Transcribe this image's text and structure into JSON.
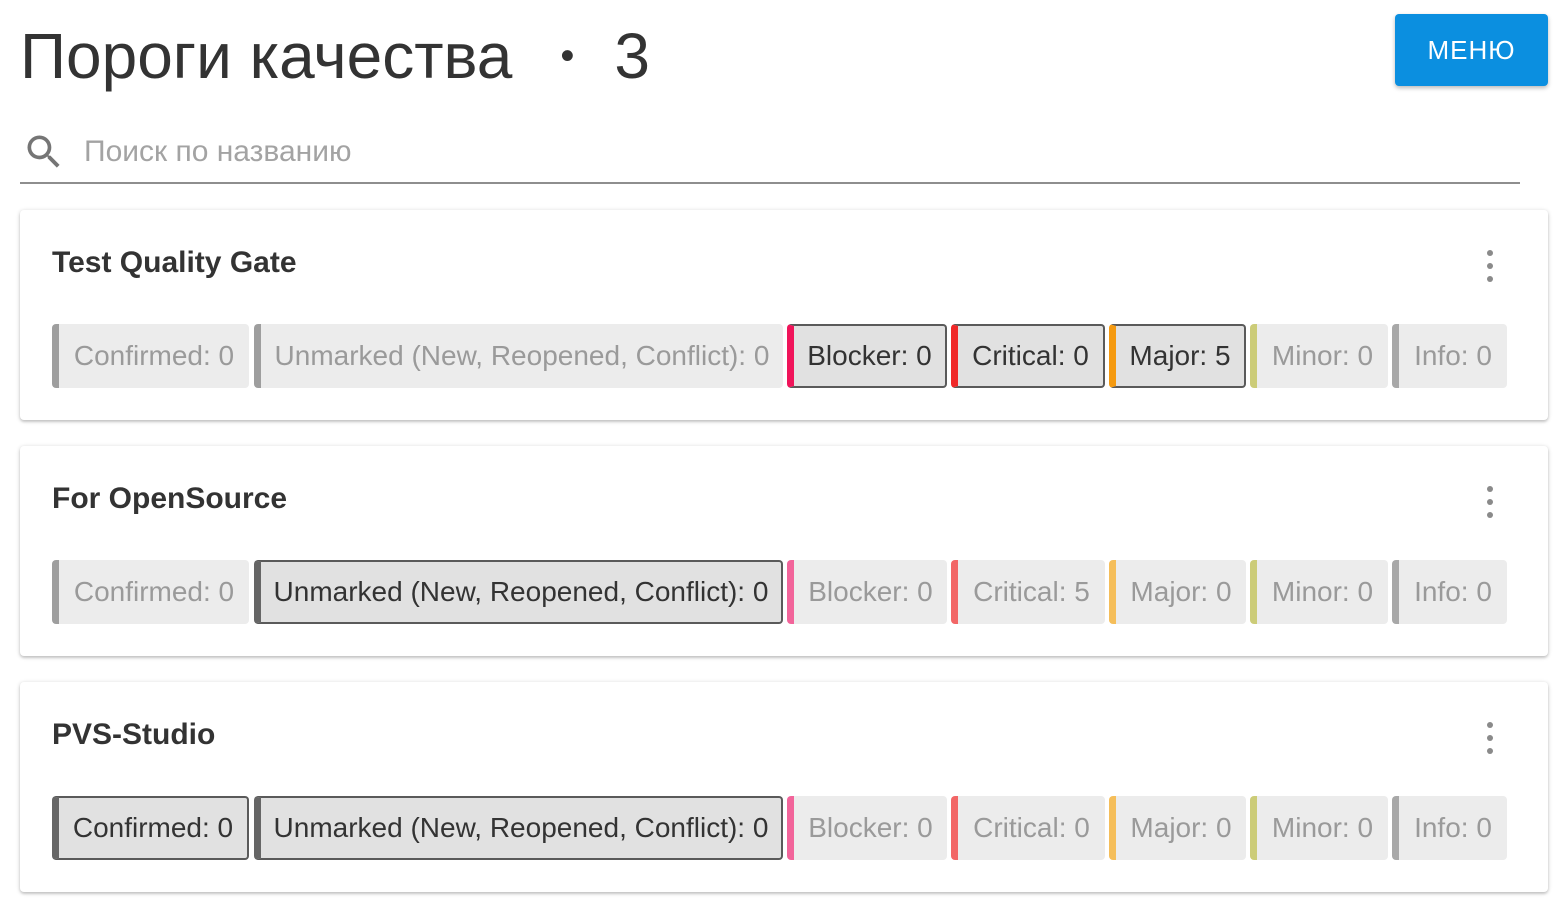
{
  "header": {
    "title": "Пороги качества",
    "separator": "•",
    "count": "3",
    "menu_label": "МЕНЮ"
  },
  "search": {
    "placeholder": "Поиск по названию",
    "value": "",
    "icon": "search-icon"
  },
  "colors": {
    "menu_button": "#0b8fe0",
    "confirmed": "#9e9e9e",
    "unmarked": "#9e9e9e",
    "blocker": "#f0145a",
    "critical": "#f02828",
    "major": "#f59a10",
    "minor": "#c8c864",
    "info": "#a8a8a8",
    "blocker_light": "#f2649a",
    "critical_light": "#f26666",
    "major_light": "#f5be5a",
    "minor_light": "#cccc78"
  },
  "cards": [
    {
      "title": "Test Quality Gate",
      "chips": [
        {
          "label": "Confirmed: 0",
          "active": false,
          "color": "#9e9e9e"
        },
        {
          "label": "Unmarked (New, Reopened, Conflict): 0",
          "active": false,
          "color": "#9e9e9e"
        },
        {
          "label": "Blocker: 0",
          "active": true,
          "color": "#f0145a"
        },
        {
          "label": "Critical: 0",
          "active": true,
          "color": "#f02828"
        },
        {
          "label": "Major: 5",
          "active": true,
          "color": "#f59a10"
        },
        {
          "label": "Minor: 0",
          "active": false,
          "color": "#cccc78"
        },
        {
          "label": "Info: 0",
          "active": false,
          "color": "#a8a8a8"
        }
      ]
    },
    {
      "title": "For OpenSource",
      "chips": [
        {
          "label": "Confirmed: 0",
          "active": false,
          "color": "#9e9e9e"
        },
        {
          "label": "Unmarked (New, Reopened, Conflict): 0",
          "active": true,
          "color": "#666666"
        },
        {
          "label": "Blocker: 0",
          "active": false,
          "color": "#f2649a"
        },
        {
          "label": "Critical: 5",
          "active": false,
          "color": "#f26666"
        },
        {
          "label": "Major: 0",
          "active": false,
          "color": "#f5be5a"
        },
        {
          "label": "Minor: 0",
          "active": false,
          "color": "#cccc78"
        },
        {
          "label": "Info: 0",
          "active": false,
          "color": "#a8a8a8"
        }
      ]
    },
    {
      "title": "PVS-Studio",
      "chips": [
        {
          "label": "Confirmed: 0",
          "active": true,
          "color": "#666666"
        },
        {
          "label": "Unmarked (New, Reopened, Conflict): 0",
          "active": true,
          "color": "#666666"
        },
        {
          "label": "Blocker: 0",
          "active": false,
          "color": "#f2649a"
        },
        {
          "label": "Critical: 0",
          "active": false,
          "color": "#f26666"
        },
        {
          "label": "Major: 0",
          "active": false,
          "color": "#f5be5a"
        },
        {
          "label": "Minor: 0",
          "active": false,
          "color": "#cccc78"
        },
        {
          "label": "Info: 0",
          "active": false,
          "color": "#a8a8a8"
        }
      ]
    }
  ]
}
